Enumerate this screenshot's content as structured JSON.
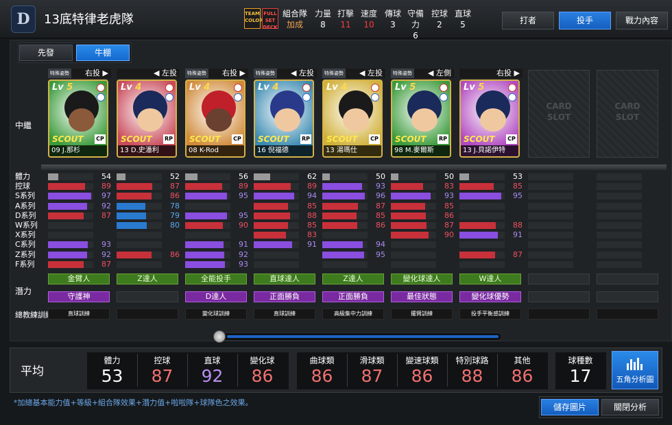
{
  "header": {
    "title": "13底特律老虎隊",
    "logo_icon": "tigers-D-logo-icon",
    "badge_team": [
      "TEAM",
      "COLOR"
    ],
    "badge_full": [
      "FULL",
      "SET",
      "DECK"
    ],
    "combo": [
      "組合隊",
      "加成"
    ],
    "stats": [
      {
        "label": "力量",
        "value": "8",
        "color": "#ffffff"
      },
      {
        "label": "打擊",
        "value": "11",
        "color": "#ff3a3a"
      },
      {
        "label": "速度",
        "value": "10",
        "color": "#ff3a3a"
      },
      {
        "label": "傳球",
        "value": "3",
        "color": "#ffffff"
      },
      {
        "label": "守備力",
        "value": "6",
        "color": "#ffffff"
      },
      {
        "label": "控球",
        "value": "2",
        "color": "#ffffff"
      },
      {
        "label": "直球",
        "value": "5",
        "color": "#ffffff"
      }
    ],
    "buttons": [
      "打者",
      "投手",
      "戰力內容"
    ],
    "active_button": 1
  },
  "subtabs": [
    "先發",
    "牛棚"
  ],
  "row_labels": {
    "position": "中繼",
    "potential": "潛力",
    "coach": "總教練訓練"
  },
  "stat_labels": [
    "體力",
    "控球",
    "S系列",
    "A系列",
    "D系列",
    "W系列",
    "X系列",
    "C系列",
    "Z系列",
    "F系列"
  ],
  "colors": {
    "red": "#c8313a",
    "purple": "#8a4ee0",
    "blue": "#2a7ad0",
    "grey": "#8a8d90",
    "stamina_fill": "#9a9a9a"
  },
  "players": [
    {
      "move": "特殊姿勢",
      "hand": "右投 ▶",
      "lv": "5",
      "type": "CP",
      "name": "09 J.那杉",
      "bg": "#3a9a3a",
      "cap": "#1a1a1a",
      "skin": "#8a5a3a",
      "stats": [
        {
          "v": 54,
          "c": "grey"
        },
        {
          "v": 89,
          "c": "red"
        },
        {
          "v": 97,
          "c": "purple"
        },
        {
          "v": 92,
          "c": "purple"
        },
        {
          "v": 87,
          "c": "red"
        },
        {
          "v": null
        },
        {
          "v": null
        },
        {
          "v": 93,
          "c": "purple"
        },
        {
          "v": 92,
          "c": "purple"
        },
        {
          "v": 87,
          "c": "red"
        }
      ],
      "pot1": "金臂人",
      "pot2": "守護神",
      "train": "直球訓練"
    },
    {
      "move": "",
      "hand": "◀ 左投",
      "lv": "4",
      "type": "RP",
      "name": "13 D.史潘利",
      "bg": "#c84a5a",
      "cap": "#1a2a5a",
      "skin": "#f0c8a0",
      "stats": [
        {
          "v": 52,
          "c": "grey"
        },
        {
          "v": 87,
          "c": "red"
        },
        {
          "v": 86,
          "c": "red"
        },
        {
          "v": 78,
          "c": "blue"
        },
        {
          "v": 79,
          "c": "blue"
        },
        {
          "v": 80,
          "c": "blue"
        },
        {
          "v": null
        },
        {
          "v": null
        },
        {
          "v": 86,
          "c": "red"
        },
        {
          "v": null
        }
      ],
      "pot1": "Z達人",
      "pot2": "",
      "train": ""
    },
    {
      "move": "特殊姿勢",
      "hand": "右投 ▶",
      "lv": "4",
      "type": "CP",
      "name": "08 K-Rod",
      "bg": "#d08a3a",
      "cap": "#c0202a",
      "skin": "#6a4030",
      "stats": [
        {
          "v": 56,
          "c": "grey"
        },
        {
          "v": 89,
          "c": "red"
        },
        {
          "v": 95,
          "c": "purple"
        },
        {
          "v": null
        },
        {
          "v": 95,
          "c": "purple"
        },
        {
          "v": 90,
          "c": "red"
        },
        {
          "v": null
        },
        {
          "v": 91,
          "c": "purple"
        },
        {
          "v": 92,
          "c": "purple"
        },
        {
          "v": 93,
          "c": "purple"
        }
      ],
      "pot1": "全能投手",
      "pot2": "D達人",
      "train": "變化球訓練"
    },
    {
      "move": "特殊姿勢",
      "hand": "◀ 左投",
      "lv": "4",
      "type": "RP",
      "name": "16 倪福德",
      "bg": "#3a8ab0",
      "cap": "#2a3a8a",
      "skin": "#f0c8a0",
      "stats": [
        {
          "v": 62,
          "c": "grey"
        },
        {
          "v": 89,
          "c": "red"
        },
        {
          "v": 94,
          "c": "purple"
        },
        {
          "v": 85,
          "c": "red"
        },
        {
          "v": 88,
          "c": "red"
        },
        {
          "v": 85,
          "c": "red"
        },
        {
          "v": 83,
          "c": "red"
        },
        {
          "v": 91,
          "c": "purple"
        },
        {
          "v": null
        },
        {
          "v": null
        }
      ],
      "pot1": "直球達人",
      "pot2": "正面勝負",
      "train": "直球訓練"
    },
    {
      "move": "特殊姿勢",
      "hand": "◀ 左投",
      "lv": "4",
      "type": "CP",
      "name": "13 湯瑪仕",
      "bg": "#d0b03a",
      "cap": "#1a1a1a",
      "skin": "#f0c8a0",
      "stats": [
        {
          "v": 50,
          "c": "grey"
        },
        {
          "v": 93,
          "c": "purple"
        },
        {
          "v": 96,
          "c": "purple"
        },
        {
          "v": 87,
          "c": "red"
        },
        {
          "v": 85,
          "c": "red"
        },
        {
          "v": 86,
          "c": "red"
        },
        {
          "v": null
        },
        {
          "v": 94,
          "c": "purple"
        },
        {
          "v": 95,
          "c": "purple"
        },
        {
          "v": null
        }
      ],
      "pot1": "Z達人",
      "pot2": "正面勝負",
      "train": "高級集中力訓練"
    },
    {
      "move": "特殊姿勢",
      "hand": "◀ 左側",
      "lv": "5",
      "type": "RP",
      "name": "98 M.麥爾斯",
      "bg": "#3a9a3a",
      "cap": "#1a2a5a",
      "skin": "#f0c8a0",
      "stats": [
        {
          "v": 50,
          "c": "grey"
        },
        {
          "v": 83,
          "c": "red"
        },
        {
          "v": 93,
          "c": "purple"
        },
        {
          "v": 85,
          "c": "red"
        },
        {
          "v": 86,
          "c": "red"
        },
        {
          "v": 87,
          "c": "red"
        },
        {
          "v": 90,
          "c": "red"
        },
        {
          "v": null
        },
        {
          "v": null
        },
        {
          "v": null
        }
      ],
      "pot1": "變化球達人",
      "pot2": "最佳狀態",
      "train": "擺臂訓練"
    },
    {
      "move": "",
      "hand": "右投 ▶",
      "lv": "5",
      "type": "CP",
      "name": "13 J.貝諾伊特",
      "bg": "#b04ac0",
      "cap": "#1a2a5a",
      "skin": "#f0c8a0",
      "stats": [
        {
          "v": 53,
          "c": "grey"
        },
        {
          "v": 85,
          "c": "red"
        },
        {
          "v": 95,
          "c": "purple"
        },
        {
          "v": null
        },
        {
          "v": null
        },
        {
          "v": 88,
          "c": "red"
        },
        {
          "v": 91,
          "c": "purple"
        },
        {
          "v": null
        },
        {
          "v": 87,
          "c": "red"
        },
        {
          "v": null
        }
      ],
      "pot1": "W達人",
      "pot2": "變化球優勢",
      "train": "投手平衡感訓練"
    }
  ],
  "empty_slot": [
    "CARD",
    "SLOT"
  ],
  "averages": {
    "label": "平均",
    "cells": [
      {
        "label": "體力",
        "value": "53",
        "color": "#ffffff"
      },
      {
        "label": "控球",
        "value": "87",
        "color": "#f07070"
      },
      {
        "label": "直球",
        "value": "92",
        "color": "#b890f0"
      },
      {
        "label": "變化球",
        "value": "86",
        "color": "#f07070"
      },
      {
        "label": "曲球類",
        "value": "86",
        "color": "#f07070"
      },
      {
        "label": "滑球類",
        "value": "87",
        "color": "#f07070"
      },
      {
        "label": "變速球類",
        "value": "86",
        "color": "#f07070"
      },
      {
        "label": "特別球路",
        "value": "88",
        "color": "#f07070"
      },
      {
        "label": "其他",
        "value": "86",
        "color": "#f07070"
      },
      {
        "label": "球種數",
        "value": "17",
        "color": "#ffffff"
      }
    ],
    "pentagon": "五角分析圖"
  },
  "footnote": "*加總基本能力值+等級+組合隊效果+潛力值+啦啦隊+球隊色之效果。",
  "bottom_buttons": [
    "儲存圖片",
    "關閉分析"
  ]
}
